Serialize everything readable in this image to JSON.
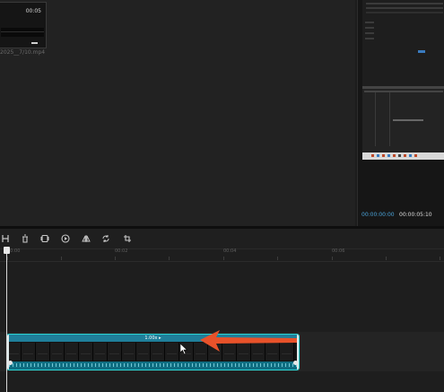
{
  "media": {
    "item": {
      "duration": "00:05",
      "filename": "2025__7/10.mp4"
    }
  },
  "player": {
    "time_current": "00:00:00:00",
    "time_total": "00:00:05:10"
  },
  "toolbar": {
    "tools": [
      {
        "icon": "split-icon"
      },
      {
        "icon": "delete-icon"
      },
      {
        "icon": "freeze-frame-icon"
      },
      {
        "icon": "play-reverse-icon"
      },
      {
        "icon": "mirror-icon"
      },
      {
        "icon": "rotate-icon"
      },
      {
        "icon": "crop-icon"
      }
    ]
  },
  "timeline": {
    "ruler_labels": [
      "00:00",
      "00:02",
      "00:04",
      "00:06"
    ],
    "clip": {
      "speed_label": "1.00x ▸",
      "accent_color": "#2bd4d4",
      "header_color": "#1f7f9a"
    }
  },
  "annotation": {
    "arrow_color": "#e8522a"
  }
}
